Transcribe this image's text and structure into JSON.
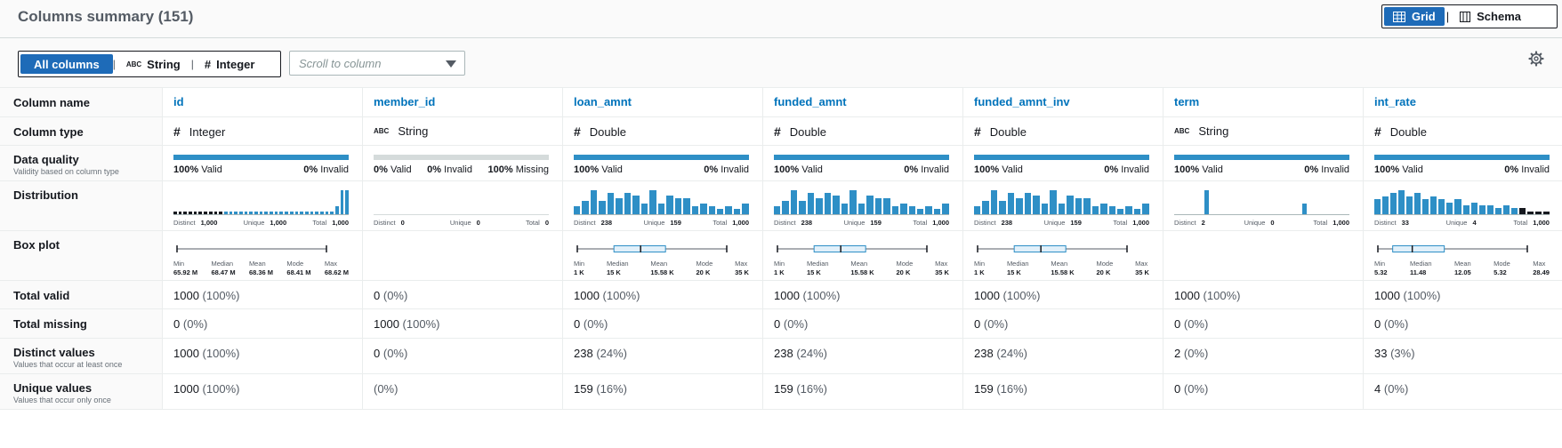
{
  "header": {
    "title": "Columns summary (151)",
    "grid_label": "Grid",
    "schema_label": "Schema"
  },
  "filter": {
    "all": "All columns",
    "string": "String",
    "integer": "Integer",
    "abc": "ABC",
    "hash": "#"
  },
  "scroll": {
    "placeholder": "Scroll to column"
  },
  "labels": {
    "column_name": "Column name",
    "column_type": "Column type",
    "data_quality": "Data quality",
    "data_quality_sub": "Validity based on column type",
    "distribution": "Distribution",
    "box_plot": "Box plot",
    "total_valid": "Total valid",
    "total_missing": "Total missing",
    "distinct_values": "Distinct values",
    "distinct_sub": "Values that occur at least once",
    "unique_values": "Unique values",
    "unique_sub": "Values that occur only once"
  },
  "stat_labels": {
    "distinct": "Distinct",
    "unique": "Unique",
    "total": "Total",
    "min": "Min",
    "median": "Median",
    "mean": "Mean",
    "mode": "Mode",
    "max": "Max",
    "valid": "Valid",
    "invalid": "Invalid",
    "missing": "Missing"
  },
  "columns": [
    {
      "name": "id",
      "type": "Integer",
      "type_sym": "#",
      "q_valid": "100%",
      "q_invalid": "0%",
      "q_missing": "",
      "q_full": true,
      "hist": [
        1,
        1,
        1,
        1,
        1,
        1,
        1,
        1,
        1,
        1,
        1,
        1,
        1,
        1,
        1,
        1,
        1,
        1,
        1,
        1,
        1,
        1,
        1,
        1,
        1,
        1,
        1,
        1,
        1,
        1,
        1,
        1,
        3,
        9,
        9
      ],
      "hist_dark": 10,
      "distinct": "1,000",
      "unique": "1,000",
      "total": "1,000",
      "box": {
        "min": "65.92 M",
        "median": "68.47 M",
        "mean": "68.36 M",
        "mode": "68.41 M",
        "max": "68.62 M"
      },
      "total_valid": "1000",
      "total_valid_pct": "(100%)",
      "total_missing": "0",
      "total_missing_pct": "(0%)",
      "distinct_v": "1000",
      "distinct_pct": "(100%)",
      "unique_v": "1000",
      "unique_pct": "(100%)"
    },
    {
      "name": "member_id",
      "type": "String",
      "type_sym": "ABC",
      "q_valid": "0%",
      "q_invalid": "0%",
      "q_missing": "100%",
      "q_full": false,
      "hist": [],
      "hist_dark": 0,
      "distinct": "0",
      "unique": "0",
      "total": "0",
      "box": null,
      "total_valid": "0",
      "total_valid_pct": "(0%)",
      "total_missing": "1000",
      "total_missing_pct": "(100%)",
      "distinct_v": "0",
      "distinct_pct": "(0%)",
      "unique_v": "",
      "unique_pct": "(0%)"
    },
    {
      "name": "loan_amnt",
      "type": "Double",
      "type_sym": "#",
      "q_valid": "100%",
      "q_invalid": "0%",
      "q_missing": "",
      "q_full": true,
      "hist": [
        3,
        5,
        9,
        5,
        8,
        6,
        8,
        7,
        4,
        9,
        4,
        7,
        6,
        6,
        3,
        4,
        3,
        2,
        3,
        2,
        4
      ],
      "hist_dark": 0,
      "distinct": "238",
      "unique": "159",
      "total": "1,000",
      "box": {
        "min": "1 K",
        "median": "15 K",
        "mean": "15.58 K",
        "mode": "20 K",
        "max": "35 K"
      },
      "total_valid": "1000",
      "total_valid_pct": "(100%)",
      "total_missing": "0",
      "total_missing_pct": "(0%)",
      "distinct_v": "238",
      "distinct_pct": "(24%)",
      "unique_v": "159",
      "unique_pct": "(16%)"
    },
    {
      "name": "funded_amnt",
      "type": "Double",
      "type_sym": "#",
      "q_valid": "100%",
      "q_invalid": "0%",
      "q_missing": "",
      "q_full": true,
      "hist": [
        3,
        5,
        9,
        5,
        8,
        6,
        8,
        7,
        4,
        9,
        4,
        7,
        6,
        6,
        3,
        4,
        3,
        2,
        3,
        2,
        4
      ],
      "hist_dark": 0,
      "distinct": "238",
      "unique": "159",
      "total": "1,000",
      "box": {
        "min": "1 K",
        "median": "15 K",
        "mean": "15.58 K",
        "mode": "20 K",
        "max": "35 K"
      },
      "total_valid": "1000",
      "total_valid_pct": "(100%)",
      "total_missing": "0",
      "total_missing_pct": "(0%)",
      "distinct_v": "238",
      "distinct_pct": "(24%)",
      "unique_v": "159",
      "unique_pct": "(16%)"
    },
    {
      "name": "funded_amnt_inv",
      "type": "Double",
      "type_sym": "#",
      "q_valid": "100%",
      "q_invalid": "0%",
      "q_missing": "",
      "q_full": true,
      "hist": [
        3,
        5,
        9,
        5,
        8,
        6,
        8,
        7,
        4,
        9,
        4,
        7,
        6,
        6,
        3,
        4,
        3,
        2,
        3,
        2,
        4
      ],
      "hist_dark": 0,
      "distinct": "238",
      "unique": "159",
      "total": "1,000",
      "box": {
        "min": "1 K",
        "median": "15 K",
        "mean": "15.58 K",
        "mode": "20 K",
        "max": "35 K"
      },
      "total_valid": "1000",
      "total_valid_pct": "(100%)",
      "total_missing": "0",
      "total_missing_pct": "(0%)",
      "distinct_v": "238",
      "distinct_pct": "(24%)",
      "unique_v": "159",
      "unique_pct": "(16%)"
    },
    {
      "name": "term",
      "type": "String",
      "type_sym": "ABC",
      "q_valid": "100%",
      "q_invalid": "0%",
      "q_missing": "",
      "q_full": true,
      "hist": [
        0,
        0,
        0,
        0,
        0,
        9,
        0,
        0,
        0,
        0,
        0,
        0,
        0,
        0,
        0,
        0,
        0,
        0,
        0,
        0,
        0,
        4,
        0,
        0,
        0,
        0,
        0,
        0,
        0
      ],
      "hist_dark": 0,
      "distinct": "2",
      "unique": "0",
      "total": "1,000",
      "box": null,
      "total_valid": "1000",
      "total_valid_pct": "(100%)",
      "total_missing": "0",
      "total_missing_pct": "(0%)",
      "distinct_v": "2",
      "distinct_pct": "(0%)",
      "unique_v": "0",
      "unique_pct": "(0%)"
    },
    {
      "name": "int_rate",
      "type": "Double",
      "type_sym": "#",
      "q_valid": "100%",
      "q_invalid": "0%",
      "q_missing": "",
      "q_full": true,
      "hist": [
        5,
        6,
        7,
        8,
        6,
        7,
        5,
        6,
        5,
        4,
        5,
        3,
        4,
        3,
        3,
        2,
        3,
        2,
        2,
        1,
        1,
        1
      ],
      "hist_dark": -4,
      "distinct": "33",
      "unique": "4",
      "total": "1,000",
      "box": {
        "min": "5.32",
        "median": "11.48",
        "mean": "12.05",
        "mode": "5.32",
        "max": "28.49"
      },
      "total_valid": "1000",
      "total_valid_pct": "(100%)",
      "total_missing": "0",
      "total_missing_pct": "(0%)",
      "distinct_v": "33",
      "distinct_pct": "(3%)",
      "unique_v": "4",
      "unique_pct": "(0%)"
    }
  ]
}
